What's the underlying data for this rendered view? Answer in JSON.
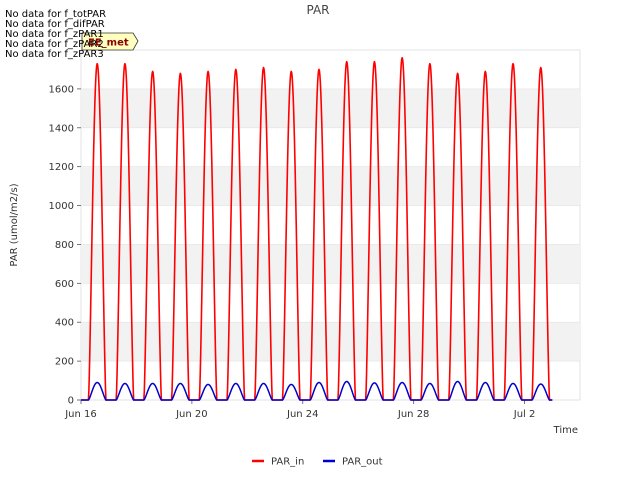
{
  "chart_data": {
    "type": "line",
    "title": "PAR",
    "xlabel": "Time",
    "ylabel": "PAR (umol/m2/s)",
    "ylim": [
      0,
      1800
    ],
    "yticks": [
      0,
      200,
      400,
      600,
      800,
      1000,
      1200,
      1400,
      1600
    ],
    "xlim": [
      "2024-06-16",
      "2024-07-04"
    ],
    "xticks": [
      {
        "date": "2024-06-16",
        "label": "Jun 16"
      },
      {
        "date": "2024-06-20",
        "label": "Jun 20"
      },
      {
        "date": "2024-06-24",
        "label": "Jun 24"
      },
      {
        "date": "2024-06-28",
        "label": "Jun 28"
      },
      {
        "date": "2024-07-02",
        "label": "Jul 2"
      }
    ],
    "grid": "horizontal alternating bands",
    "legend_position": "bottom-center",
    "series": [
      {
        "name": "PAR_in",
        "color": "#ff0000",
        "daily_peaks": [
          {
            "date": "2024-06-16",
            "peak": 1730
          },
          {
            "date": "2024-06-17",
            "peak": 1730
          },
          {
            "date": "2024-06-18",
            "peak": 1690
          },
          {
            "date": "2024-06-19",
            "peak": 1680
          },
          {
            "date": "2024-06-20",
            "peak": 1690
          },
          {
            "date": "2024-06-21",
            "peak": 1700
          },
          {
            "date": "2024-06-22",
            "peak": 1710
          },
          {
            "date": "2024-06-23",
            "peak": 1690
          },
          {
            "date": "2024-06-24",
            "peak": 1700
          },
          {
            "date": "2024-06-25",
            "peak": 1740
          },
          {
            "date": "2024-06-26",
            "peak": 1740
          },
          {
            "date": "2024-06-27",
            "peak": 1760
          },
          {
            "date": "2024-06-28",
            "peak": 1730
          },
          {
            "date": "2024-06-29",
            "peak": 1680
          },
          {
            "date": "2024-06-30",
            "peak": 1690
          },
          {
            "date": "2024-07-01",
            "peak": 1730
          },
          {
            "date": "2024-07-02",
            "peak": 1710
          }
        ]
      },
      {
        "name": "PAR_out",
        "color": "#0000cc",
        "daily_peaks": [
          {
            "date": "2024-06-16",
            "peak": 90
          },
          {
            "date": "2024-06-17",
            "peak": 85
          },
          {
            "date": "2024-06-18",
            "peak": 85
          },
          {
            "date": "2024-06-19",
            "peak": 85
          },
          {
            "date": "2024-06-20",
            "peak": 80
          },
          {
            "date": "2024-06-21",
            "peak": 85
          },
          {
            "date": "2024-06-22",
            "peak": 85
          },
          {
            "date": "2024-06-23",
            "peak": 80
          },
          {
            "date": "2024-06-24",
            "peak": 90
          },
          {
            "date": "2024-06-25",
            "peak": 95
          },
          {
            "date": "2024-06-26",
            "peak": 88
          },
          {
            "date": "2024-06-27",
            "peak": 90
          },
          {
            "date": "2024-06-28",
            "peak": 85
          },
          {
            "date": "2024-06-29",
            "peak": 95
          },
          {
            "date": "2024-06-30",
            "peak": 90
          },
          {
            "date": "2024-07-01",
            "peak": 85
          },
          {
            "date": "2024-07-02",
            "peak": 82
          }
        ]
      }
    ]
  },
  "no_data_messages": [
    "No data for f_totPAR",
    "No data for f_difPAR",
    "No data for f_zPAR1",
    "No data for f_zPAR2",
    "No data for f_zPAR3"
  ],
  "tooltip": {
    "text": "EE_met"
  }
}
